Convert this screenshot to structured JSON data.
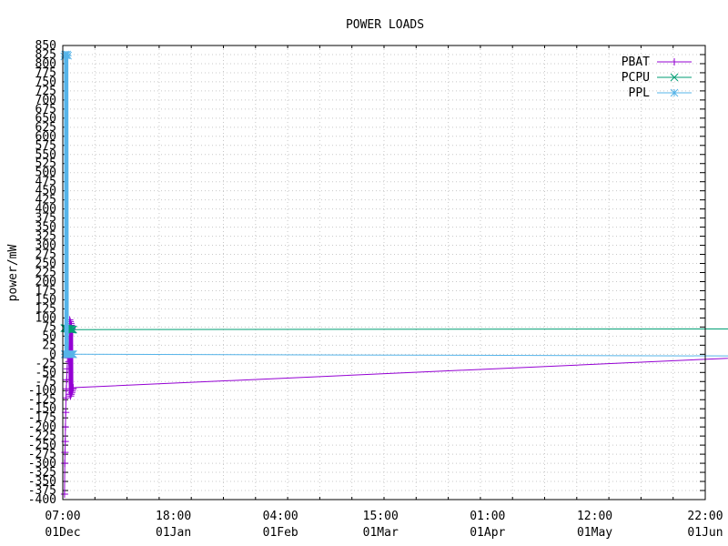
{
  "chart_data": {
    "type": "line",
    "title": "POWER LOADS",
    "ylabel": "power/mW",
    "xlabel": "",
    "ylim": [
      -400,
      850
    ],
    "y_tick_step": 25,
    "grid": true,
    "legend_position": "top-right",
    "x_ticks": [
      {
        "time": "07:00",
        "date": "01Dec"
      },
      {
        "time": "18:00",
        "date": "01Jan"
      },
      {
        "time": "04:00",
        "date": "01Feb"
      },
      {
        "time": "15:00",
        "date": "01Mar"
      },
      {
        "time": "01:00",
        "date": "01Apr"
      },
      {
        "time": "12:00",
        "date": "01May"
      },
      {
        "time": "22:00",
        "date": "01Jun"
      }
    ],
    "series": [
      {
        "name": "PBAT",
        "color": "#9400d3",
        "marker": "plus",
        "points": [
          [
            "01Dec 19:00",
            -385
          ],
          [
            "01Dec 20:30",
            -300
          ],
          [
            "01Dec 22:00",
            -270
          ],
          [
            "01Dec 23:30",
            -240
          ],
          [
            "02Dec 01:00",
            -200
          ],
          [
            "02Dec 03:00",
            -160
          ],
          [
            "02Dec 05:00",
            -120
          ],
          [
            "02Dec 07:00",
            -95
          ],
          [
            "02Dec 10:00",
            -70
          ],
          [
            "02Dec 13:00",
            -40
          ],
          [
            "02Dec 16:00",
            -10
          ],
          [
            "02Dec 19:00",
            20
          ],
          [
            "02Dec 22:00",
            50
          ],
          [
            "03Dec 00:00",
            -20
          ],
          [
            "03Dec 02:00",
            -70
          ],
          [
            "03Dec 04:00",
            -100
          ],
          [
            "03Dec 06:00",
            95
          ],
          [
            "03Dec 08:00",
            -110
          ],
          [
            "03Dec 10:00",
            90
          ],
          [
            "03Dec 12:00",
            -115
          ],
          [
            "03Dec 14:00",
            85
          ],
          [
            "03Dec 16:00",
            -110
          ],
          [
            "03Dec 18:00",
            80
          ],
          [
            "03Dec 20:00",
            -105
          ],
          [
            "03Dec 22:00",
            70
          ],
          [
            "04Dec 00:00",
            -100
          ],
          [
            "04Dec 02:00",
            60
          ],
          [
            "04Dec 04:00",
            -95
          ],
          [
            "04Dec 06:00",
            -92
          ],
          [
            "22Jun 10:00",
            -5
          ],
          [
            "22Jun 13:00",
            40
          ],
          [
            "22Jun 16:00",
            -10
          ],
          [
            "22Jun 19:00",
            45
          ],
          [
            "22Jun 22:00",
            -5
          ],
          [
            "23Jun 01:00",
            40
          ],
          [
            "23Jun 04:00",
            0
          ]
        ]
      },
      {
        "name": "PCPU",
        "color": "#009e73",
        "marker": "x",
        "points": [
          [
            "01Dec 18:00",
            72
          ],
          [
            "02Dec 00:00",
            72
          ],
          [
            "02Dec 06:00",
            71
          ],
          [
            "02Dec 12:00",
            71
          ],
          [
            "02Dec 18:00",
            70
          ],
          [
            "03Dec 00:00",
            70
          ],
          [
            "03Dec 06:00",
            69
          ],
          [
            "03Dec 12:00",
            69
          ],
          [
            "03Dec 18:00",
            68
          ],
          [
            "04Dec 00:00",
            68
          ],
          [
            "04Dec 06:00",
            68
          ],
          [
            "22Jun 10:00",
            70
          ],
          [
            "22Jun 16:00",
            70
          ],
          [
            "22Jun 22:00",
            70
          ],
          [
            "23Jun 04:00",
            70
          ]
        ]
      },
      {
        "name": "PPL",
        "color": "#56b4e9",
        "marker": "star",
        "points": [
          [
            "01Dec 18:00",
            820
          ],
          [
            "01Dec 21:00",
            0
          ],
          [
            "02Dec 00:00",
            825
          ],
          [
            "02Dec 03:00",
            0
          ],
          [
            "02Dec 06:00",
            823
          ],
          [
            "02Dec 09:00",
            0
          ],
          [
            "02Dec 12:00",
            825
          ],
          [
            "02Dec 15:00",
            0
          ],
          [
            "02Dec 18:00",
            822
          ],
          [
            "02Dec 21:00",
            0
          ],
          [
            "03Dec 00:00",
            0
          ],
          [
            "03Dec 06:00",
            0
          ],
          [
            "03Dec 12:00",
            0
          ],
          [
            "03Dec 18:00",
            0
          ],
          [
            "04Dec 00:00",
            0
          ],
          [
            "04Dec 06:00",
            0
          ],
          [
            "22Jun 10:00",
            -5
          ],
          [
            "22Jun 16:00",
            -3
          ],
          [
            "22Jun 22:00",
            -2
          ],
          [
            "23Jun 04:00",
            -1
          ]
        ]
      }
    ]
  }
}
